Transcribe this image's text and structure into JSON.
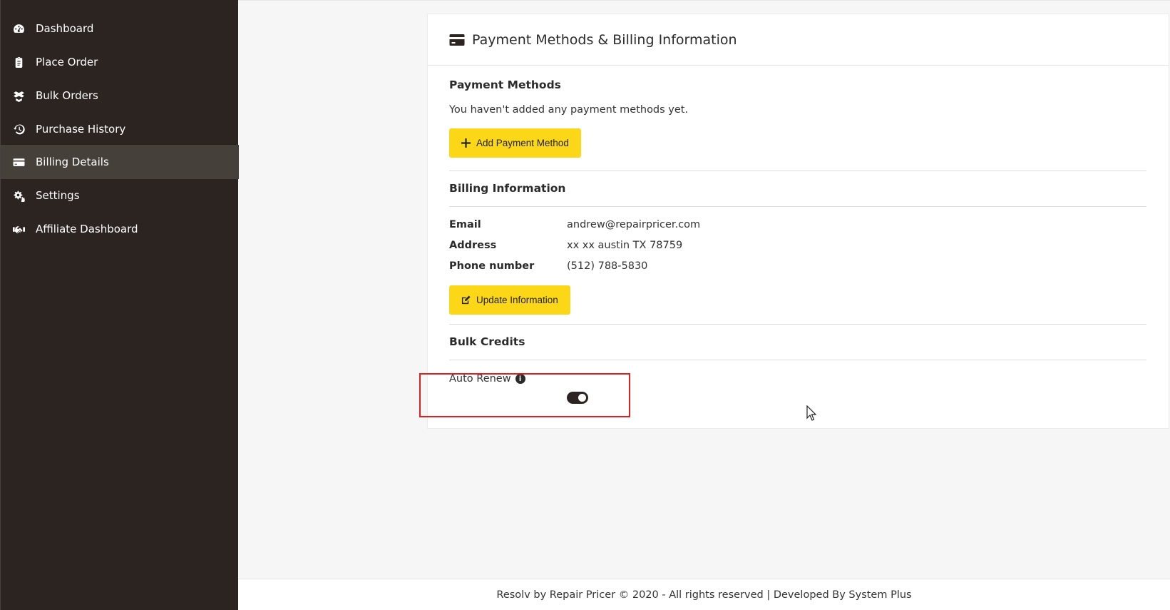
{
  "sidebar": {
    "items": [
      {
        "label": "Dashboard",
        "icon": "tachometer-icon"
      },
      {
        "label": "Place Order",
        "icon": "clipboard-icon"
      },
      {
        "label": "Bulk Orders",
        "icon": "boxes-icon"
      },
      {
        "label": "Purchase History",
        "icon": "history-icon"
      },
      {
        "label": "Billing Details",
        "icon": "credit-card-icon",
        "active": true
      },
      {
        "label": "Settings",
        "icon": "cogs-icon"
      },
      {
        "label": "Affiliate Dashboard",
        "icon": "handshake-icon"
      }
    ]
  },
  "card": {
    "title": "Payment Methods & Billing Information",
    "payment_methods": {
      "heading": "Payment Methods",
      "empty_text": "You haven't added any payment methods yet.",
      "add_button": "Add Payment Method"
    },
    "billing_info": {
      "heading": "Billing Information",
      "email_label": "Email",
      "email_value": "andrew@repairpricer.com",
      "address_label": "Address",
      "address_value": "xx xx austin TX 78759",
      "phone_label": "Phone number",
      "phone_value": "(512) 788-5830",
      "update_button": "Update Information"
    },
    "bulk_credits": {
      "heading": "Bulk Credits",
      "auto_renew_label": "Auto Renew",
      "auto_renew_on": true
    }
  },
  "footer": {
    "text": "Resolv by Repair Pricer © 2020 - All rights reserved | Developed By System Plus"
  },
  "colors": {
    "sidebar_bg": "#2b2420",
    "sidebar_active": "#46403b",
    "accent_yellow": "#fbd718",
    "highlight_red": "#e02020"
  }
}
